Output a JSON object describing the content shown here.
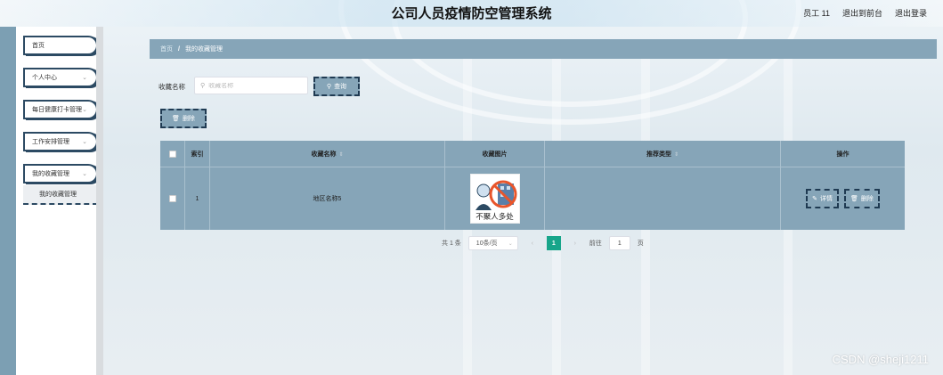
{
  "header": {
    "title": "公司人员疫情防空管理系统",
    "user": "员工 11",
    "back_to_front": "退出到前台",
    "logout": "退出登录"
  },
  "sidebar": {
    "items": [
      {
        "label": "首页",
        "has_chevron": false
      },
      {
        "label": "个人中心",
        "has_chevron": true
      },
      {
        "label": "每日健康打卡管理",
        "has_chevron": true
      },
      {
        "label": "工作安排管理",
        "has_chevron": true
      },
      {
        "label": "我的收藏管理",
        "has_chevron": true
      }
    ],
    "submenu": {
      "label": "我的收藏管理"
    }
  },
  "breadcrumb": {
    "home": "首页",
    "separator": "/",
    "current": "我的收藏管理"
  },
  "search": {
    "label": "收藏名称",
    "placeholder": "收藏名称",
    "button": "查询"
  },
  "actions": {
    "delete": "删除"
  },
  "table": {
    "headers": {
      "index": "索引",
      "name": "收藏名称",
      "image": "收藏图片",
      "type": "推荐类型",
      "ops": "操作"
    },
    "rows": [
      {
        "index": "1",
        "name": "地区名称5",
        "image_text": "不聚人多处",
        "type": "",
        "detail_btn": "详情",
        "delete_btn": "删除"
      }
    ]
  },
  "pagination": {
    "total": "共 1 条",
    "page_size": "10条/页",
    "current_page": "1",
    "goto_label": "前往",
    "goto_value": "1",
    "page_suffix": "页"
  },
  "watermark": "CSDN @sheji1211",
  "colors": {
    "accent": "#86a5b8",
    "border_dark": "#1f3a52",
    "active_page": "#17a58a",
    "sidebar_bar": "#7c9fb3"
  }
}
